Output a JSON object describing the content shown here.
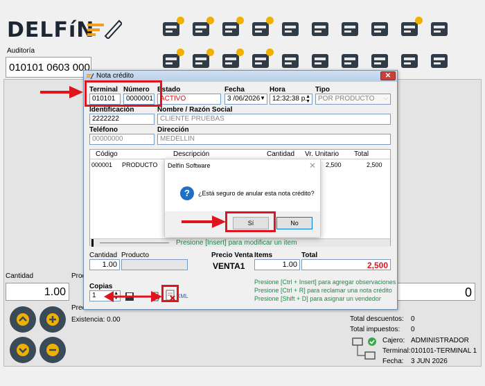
{
  "header": {
    "logo_text": "DELFíN",
    "toolbar_row1": [
      "bed-icon",
      "presenter-icon",
      "user-money-icon",
      "user-clock-icon",
      "percent-badge-icon",
      "document-list-icon",
      "printer-icon",
      "cash-register-icon",
      "card-payment-icon",
      "user-refresh-icon"
    ],
    "toolbar_row2": [
      "bed-add-icon",
      "presenter-add-icon",
      "user-add-icon",
      "user-add2-icon",
      "trash-icon",
      "bottle-search-icon",
      "scale-icon",
      "credit-note-icon",
      "money-icon",
      "more-icon"
    ]
  },
  "auditoria": {
    "label": "Auditoría",
    "value": "010101 0603 0001"
  },
  "left_panel": {
    "cantidad_label": "Cantidad",
    "cantidad_value": "1.00",
    "prod_label": "Prod",
    "prec_label": "Prec",
    "existencia": "Existencia:  0.00",
    "right_value": "0"
  },
  "totals": {
    "descuentos_label": "Total descuentos:",
    "descuentos_value": "0",
    "impuestos_label": "Total impuestos:",
    "impuestos_value": "0",
    "cajero_label": "Cajero:",
    "cajero_value": "ADMINISTRADOR",
    "terminal_label": "Terminal:",
    "terminal_value": "010101-TERMINAL 1",
    "fecha_label": "Fecha:",
    "fecha_value": "3 JUN 2026"
  },
  "dialog": {
    "title": "Nota crédito",
    "close_label": "✕",
    "terminal_label": "Terminal",
    "terminal_value": "010101",
    "numero_label": "Número",
    "numero_value": "0000001",
    "estado_label": "Estado",
    "estado_value": "ACTIVO",
    "fecha_label": "Fecha",
    "fecha_value": "3 /06/2026",
    "hora_label": "Hora",
    "hora_value": "12:32:38 p.",
    "tipo_label": "Tipo",
    "tipo_value": "POR PRODUCTO",
    "identificacion_label": "Identificación",
    "identificacion_value": "2222222",
    "nombre_label": "Nombre / Razón Social",
    "nombre_value": "CLIENTE PRUEBAS",
    "telefono_label": "Teléfono",
    "telefono_value": "00000000",
    "direccion_label": "Dirección",
    "direccion_value": "MEDELLIN",
    "grid_headers": [
      "Código",
      "Descripción",
      "Cantidad",
      "Vr. Unitario",
      "Total"
    ],
    "grid_row": {
      "codigo": "000001",
      "descripcion": "PRODUCTO",
      "unitario": "2,500",
      "total": "2,500"
    },
    "grid_footer": "Presione [Insert] para modificar un item",
    "cantidad_label": "Cantidad",
    "cantidad_value": "1.00",
    "producto_label": "Producto",
    "precio_venta_label": "Precio Venta",
    "precio_venta_value": "VENTA1",
    "items_label": "Items",
    "items_value": "1.00",
    "total_label": "Total",
    "total_value": "2,500",
    "copias_label": "Copias",
    "copias_value": "1",
    "xml_label": "XML",
    "help": [
      "Presione [Ctrl + Insert] para agregar observaciones",
      "Presione [Ctrl + R] para reclamar una nota crédito",
      "Presione [Shift + D] para asignar un vendedor"
    ]
  },
  "message_box": {
    "title": "Delfín Software",
    "close": "✕",
    "text": "¿Está seguro de anular esta nota crédito?",
    "yes": "Sí",
    "no": "No"
  },
  "colors": {
    "accent_red": "#e0141c",
    "link_green": "#1c8a4a",
    "dark": "#3a4a57",
    "badge": "#f0b000"
  }
}
